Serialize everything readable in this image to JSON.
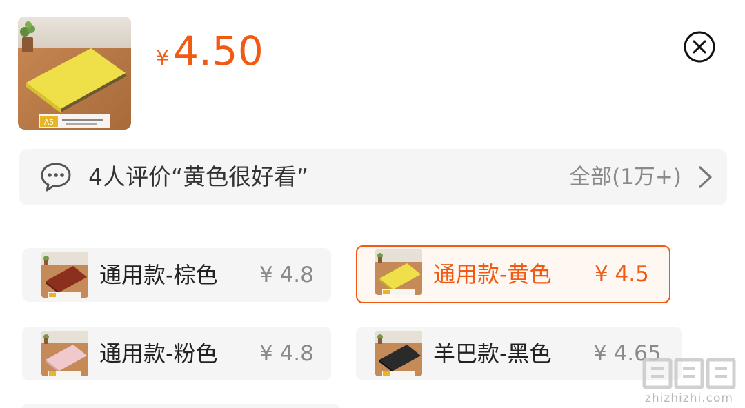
{
  "header": {
    "currency": "¥",
    "price": "4.50",
    "thumb_caption": "A5"
  },
  "review": {
    "text": "4人评价“黄色很好看”",
    "all_label": "全部(1万+)"
  },
  "variants": [
    {
      "label": "通用款-棕色",
      "price": "¥ 4.8",
      "color": "#8b2f1e",
      "selected": false
    },
    {
      "label": "通用款-黄色",
      "price": "¥ 4.5",
      "color": "#e8d75a",
      "selected": true
    },
    {
      "label": "通用款-粉色",
      "price": "¥ 4.8",
      "color": "#f1c9cc",
      "selected": false
    },
    {
      "label": "羊巴款-黑色",
      "price": "¥ 4.65",
      "color": "#2a2a2a",
      "selected": false
    }
  ],
  "watermark": {
    "text": "zhizhizhi.com"
  },
  "colors": {
    "accent": "#f05a12",
    "chip_bg": "#f5f5f5",
    "text_gray": "#8a8a8a"
  },
  "icons": {
    "close": "close-circle-icon",
    "review": "chat-bubble-icon",
    "more": "chevron-right-icon"
  }
}
